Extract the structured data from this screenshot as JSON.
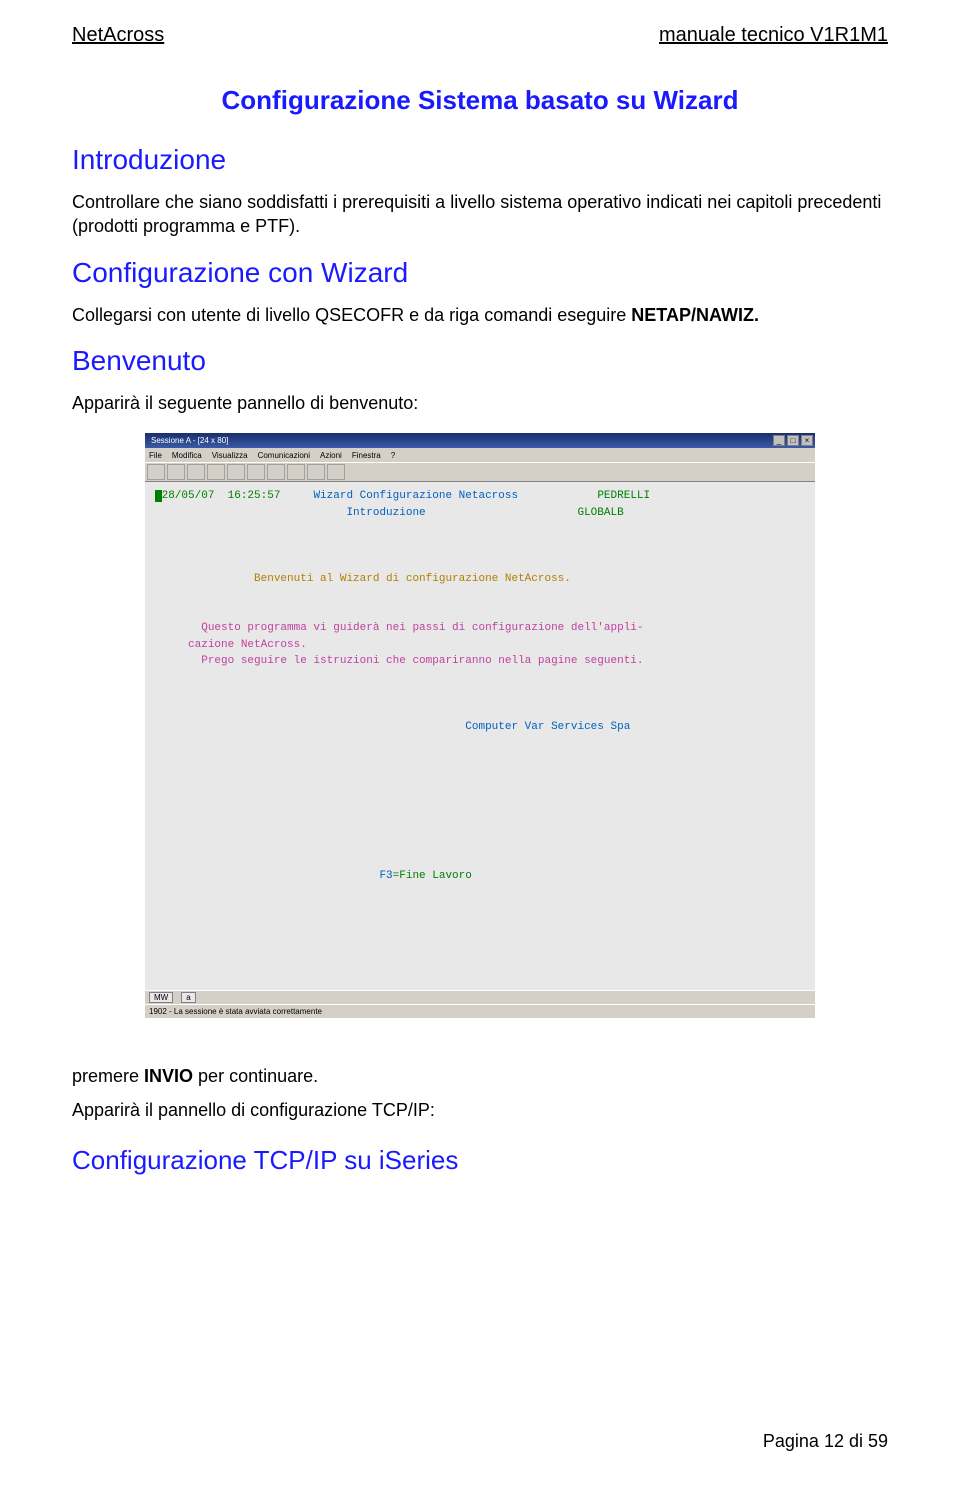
{
  "header": {
    "left": "NetAcross",
    "right": "manuale tecnico V1R1M1"
  },
  "title": "Configurazione Sistema basato su Wizard",
  "sections": {
    "intro_h": "Introduzione",
    "intro_p": "Controllare che siano soddisfatti i prerequisiti a livello sistema operativo indicati nei capitoli precedenti (prodotti programma e PTF).",
    "conf_h": "Configurazione con Wizard",
    "conf_p_pre": "Collegarsi con utente di livello QSECOFR e da riga comandi eseguire ",
    "conf_p_cmd": "NETAP/NAWIZ.",
    "benv_h": "Benvenuto",
    "benv_p": "Apparirà il seguente pannello di benvenuto:",
    "after1_pre": "premere ",
    "after1_bold": "INVIO",
    "after1_post": " per continuare.",
    "after2": "Apparirà il pannello di configurazione TCP/IP:",
    "tcp_h": "Configurazione TCP/IP su iSeries"
  },
  "terminal": {
    "window_title": "Sessione A - [24 x 80]",
    "menubar": [
      "File",
      "Modifica",
      "Visualizza",
      "Comunicazioni",
      "Azioni",
      "Finestra",
      "?"
    ],
    "status": {
      "mw": "MW",
      "a": "a",
      "msg": "1902 - La sessione è stata avviata correttamente"
    },
    "lines": {
      "l1_date": "28/05/07",
      "l1_time": "16:25:57",
      "l1_title": "Wizard Configurazione Netacross",
      "l1_user": "PEDRELLI",
      "l2_sub": "Introduzione",
      "l2_sys": "GLOBALB",
      "welcome": "Benvenuti al Wizard di configurazione NetAcross.",
      "p1a": "Questo programma vi guiderà nei passi di configurazione dell'appli-",
      "p1b": "cazione NetAcross.",
      "p2": "Prego seguire le istruzioni che compariranno nella pagine seguenti.",
      "company": "Computer Var Services Spa",
      "fkey_key": "F3",
      "fkey_label": "=Fine Lavoro"
    }
  },
  "footer": "Pagina 12 di 59"
}
